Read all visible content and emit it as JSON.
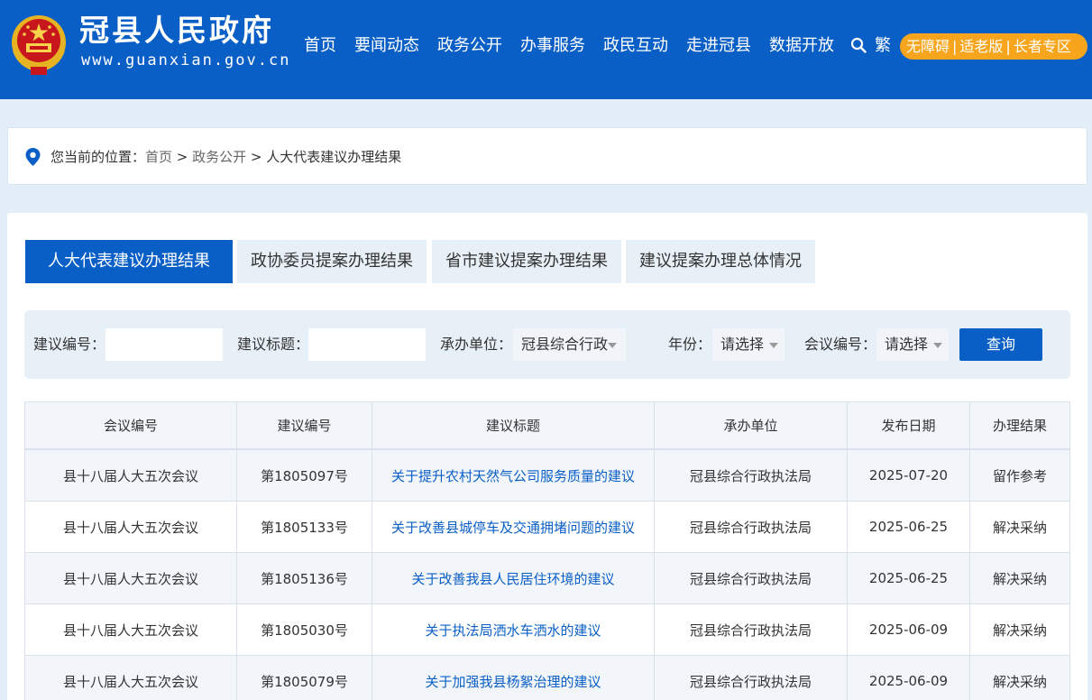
{
  "header": {
    "site_name": "冠县人民政府",
    "site_url": "www.guanxian.gov.cn",
    "nav": [
      "首页",
      "要闻动态",
      "政务公开",
      "办事服务",
      "政民互动",
      "走进冠县",
      "数据开放"
    ],
    "traditional": "繁",
    "accessibility": [
      "无障碍",
      "适老版",
      "长者专区"
    ],
    "accessibility_sep": "|"
  },
  "breadcrumb": {
    "prefix": "您当前的位置：",
    "items": [
      "首页",
      "政务公开",
      "人大代表建议办理结果"
    ],
    "separator": " > "
  },
  "tabs": [
    "人大代表建议办理结果",
    "政协委员提案办理结果",
    "省市建议提案办理结果",
    "建议提案办理总体情况"
  ],
  "filter": {
    "proposal_no_label": "建议编号：",
    "proposal_no_value": "",
    "title_label": "建议标题：",
    "title_value": "",
    "unit_label": "承办单位：",
    "unit_value": "冠县综合行政",
    "year_label": "年份：",
    "year_value": "请选择",
    "meeting_label": "会议编号：",
    "meeting_value": "请选择",
    "query": "查询"
  },
  "table": {
    "headers": [
      "会议编号",
      "建议编号",
      "建议标题",
      "承办单位",
      "发布日期",
      "办理结果"
    ],
    "rows": [
      [
        "县十八届人大五次会议",
        "第1805097号",
        "关于提升农村天然气公司服务质量的建议",
        "冠县综合行政执法局",
        "2025-07-20",
        "留作参考"
      ],
      [
        "县十八届人大五次会议",
        "第1805133号",
        "关于改善县城停车及交通拥堵问题的建议",
        "冠县综合行政执法局",
        "2025-06-25",
        "解决采纳"
      ],
      [
        "县十八届人大五次会议",
        "第1805136号",
        "关于改善我县人民居住环境的建议",
        "冠县综合行政执法局",
        "2025-06-25",
        "解决采纳"
      ],
      [
        "县十八届人大五次会议",
        "第1805030号",
        "关于执法局洒水车洒水的建议",
        "冠县综合行政执法局",
        "2025-06-09",
        "解决采纳"
      ],
      [
        "县十八届人大五次会议",
        "第1805079号",
        "关于加强我县杨絮治理的建议",
        "冠县综合行政执法局",
        "2025-06-09",
        "解决采纳"
      ]
    ]
  },
  "colors": {
    "primary": "#0a5fc7",
    "accent": "#f7a51d",
    "page_bg": "#e3eef8"
  },
  "icons": [
    "national-emblem-icon",
    "search-icon",
    "location-pin-icon",
    "caret-down-icon"
  ]
}
